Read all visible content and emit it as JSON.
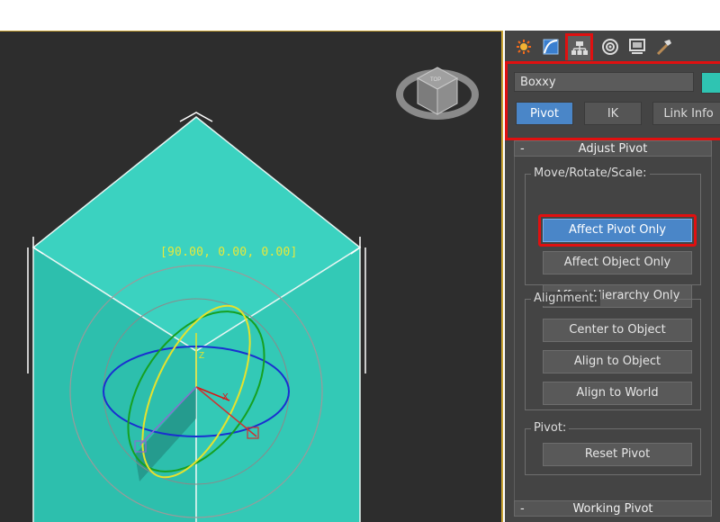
{
  "viewport": {
    "transform_readout": "[90.00, 0.00, 0.00]",
    "gizmo_axis_z": "Z",
    "gizmo_axis_x": "X",
    "viewcube_face": "TOP"
  },
  "command_panel": {
    "tabs": [
      {
        "icon": "create-icon"
      },
      {
        "icon": "modify-icon"
      },
      {
        "icon": "hierarchy-icon",
        "active": true
      },
      {
        "icon": "motion-icon"
      },
      {
        "icon": "display-icon"
      },
      {
        "icon": "utilities-icon"
      }
    ],
    "object_name": "Boxxy",
    "object_color": "#2fc4b2",
    "subtabs": [
      "Pivot",
      "IK",
      "Link Info"
    ],
    "active_subtab": "Pivot",
    "adjust_pivot": {
      "title": "Adjust Pivot",
      "collapse_symbol": "-",
      "move_group_label": "Move/Rotate/Scale:",
      "affect_pivot_only": "Affect Pivot Only",
      "affect_object_only": "Affect Object Only",
      "affect_hierarchy_only": "Affect Hierarchy Only",
      "alignment_label": "Alignment:",
      "center_to_object": "Center to Object",
      "align_to_object": "Align to Object",
      "align_to_world": "Align to World",
      "pivot_label": "Pivot:",
      "reset_pivot": "Reset Pivot"
    },
    "working_pivot": {
      "title": "Working Pivot",
      "collapse_symbol": "-"
    }
  },
  "colors": {
    "highlight": "#e01010",
    "active_button": "#4a86c8",
    "box": "#2fc4b2",
    "readout": "#e8e83a"
  }
}
